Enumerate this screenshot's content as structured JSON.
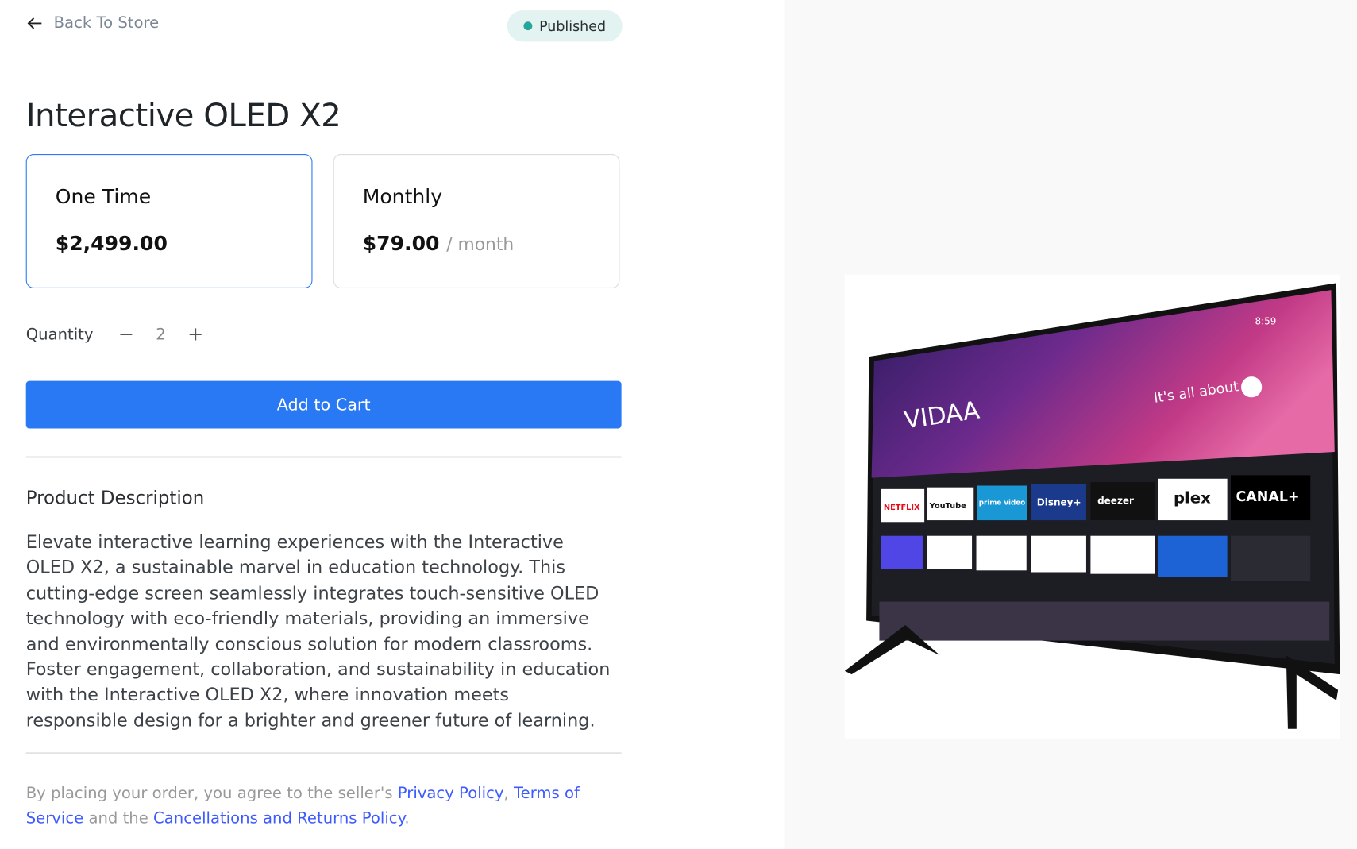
{
  "header": {
    "back_label": "Back To Store",
    "status": "Published",
    "status_color": "#26a69a"
  },
  "product": {
    "title": "Interactive OLED X2"
  },
  "plans": [
    {
      "name": "One Time",
      "price": "$2,499.00",
      "period": "",
      "selected": true
    },
    {
      "name": "Monthly",
      "price": "$79.00",
      "period": "/ month",
      "selected": false
    }
  ],
  "quantity": {
    "label": "Quantity",
    "value": "2",
    "decrement": "−",
    "increment": "+"
  },
  "cart": {
    "label": "Add to Cart",
    "color": "#2979f5"
  },
  "description": {
    "heading": "Product Description",
    "text": "Elevate interactive learning experiences with the Interactive OLED X2, a sustainable marvel in education technology. This cutting-edge screen seamlessly integrates touch-sensitive OLED technology with eco-friendly materials, providing an immersive and environmentally conscious solution for modern classrooms. Foster engagement, collaboration, and sustainability in education with the Interactive OLED X2, where innovation meets responsible design for a brighter and greener future of learning."
  },
  "legal": {
    "prefix": "By placing your order, you agree to the seller's ",
    "privacy": "Privacy Policy",
    "sep": ", ",
    "terms": "Terms of Service",
    "mid": " and the ",
    "returns": "Cancellations and Returns Policy",
    "end": "."
  },
  "image_lettering": {
    "brand": "VIDAA",
    "tagline": "It's all about",
    "clock": "8:59",
    "apps": [
      "NETFLIX",
      "YouTube",
      "prime video",
      "Disney+",
      "deezer",
      "plex",
      "CANAL+"
    ]
  }
}
